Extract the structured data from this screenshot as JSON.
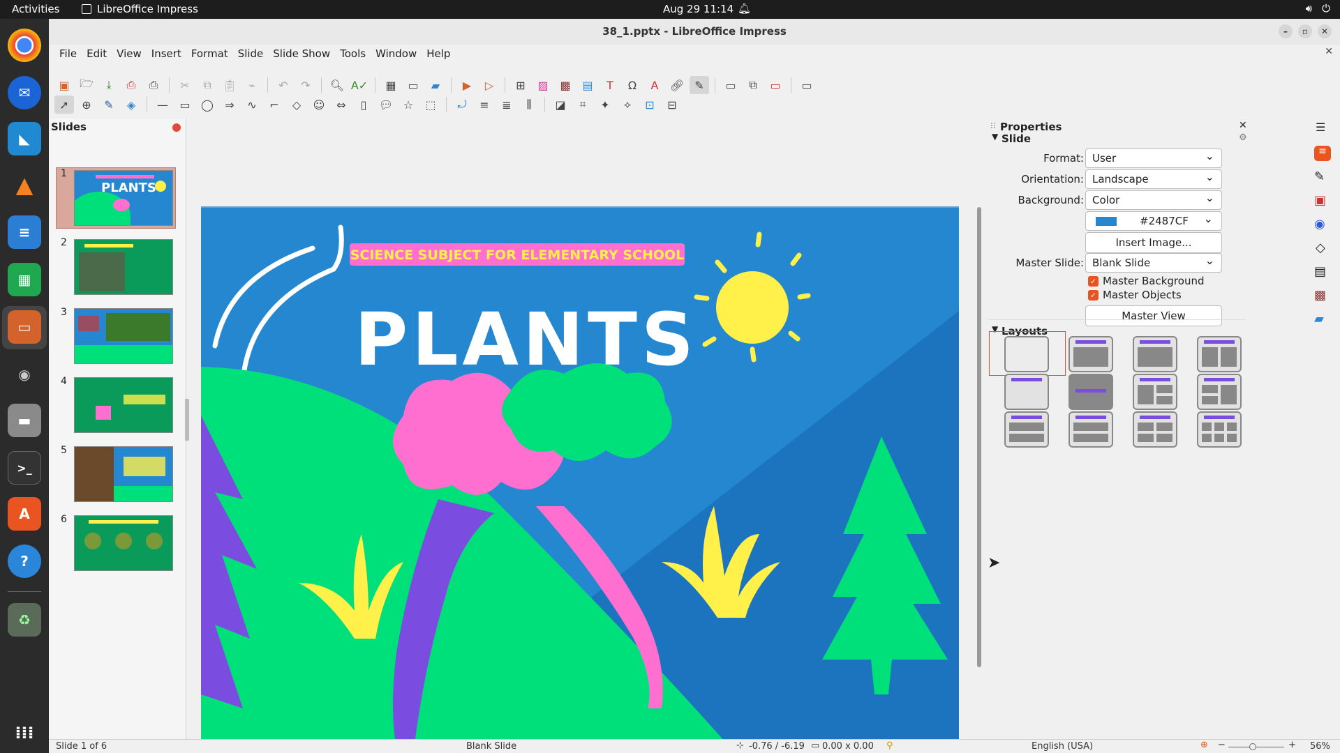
{
  "topbar": {
    "activities": "Activities",
    "app_name": "LibreOffice Impress",
    "clock": "Aug 29  11:14"
  },
  "window": {
    "title": "38_1.pptx - LibreOffice Impress"
  },
  "menu": [
    "File",
    "Edit",
    "View",
    "Insert",
    "Format",
    "Slide",
    "Slide Show",
    "Tools",
    "Window",
    "Help"
  ],
  "slides_panel": {
    "title": "Slides",
    "numbers": [
      "1",
      "2",
      "3",
      "4",
      "5",
      "6"
    ]
  },
  "slide": {
    "banner": "SCIENCE SUBJECT FOR ELEMENTARY SCHOOL",
    "title": "PLANTS",
    "colors": {
      "background": "#2487CF",
      "banner": "#FF6FCF",
      "banner_text": "#FFF04A",
      "hill": "#00E07A",
      "pink": "#FF6FCF",
      "purple": "#7A4DE0",
      "yellow": "#FFF04A"
    }
  },
  "properties": {
    "title": "Properties",
    "slide_section": "Slide",
    "format_label": "Format:",
    "format_value": "User",
    "orientation_label": "Orientation:",
    "orientation_value": "Landscape",
    "background_label": "Background:",
    "background_value": "Color",
    "color_value": "#2487CF",
    "insert_image": "Insert Image...",
    "master_label": "Master Slide:",
    "master_value": "Blank Slide",
    "master_background": "Master Background",
    "master_objects": "Master Objects",
    "master_view": "Master View",
    "layouts_section": "Layouts"
  },
  "status": {
    "slide_count": "Slide 1 of 6",
    "layout": "Blank Slide",
    "position": "-0.76 / -6.19",
    "size": "0.00 x 0.00",
    "language": "English (USA)",
    "zoom": "56%"
  }
}
